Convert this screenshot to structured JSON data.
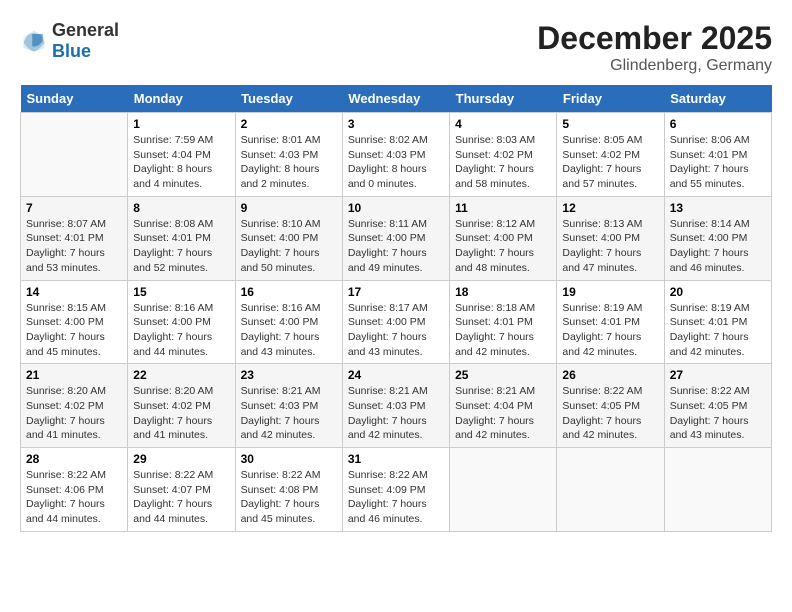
{
  "header": {
    "logo_general": "General",
    "logo_blue": "Blue",
    "title": "December 2025",
    "location": "Glindenberg, Germany"
  },
  "days_of_week": [
    "Sunday",
    "Monday",
    "Tuesday",
    "Wednesday",
    "Thursday",
    "Friday",
    "Saturday"
  ],
  "weeks": [
    [
      {
        "day": "",
        "sunrise": "",
        "sunset": "",
        "daylight": ""
      },
      {
        "day": "1",
        "sunrise": "Sunrise: 7:59 AM",
        "sunset": "Sunset: 4:04 PM",
        "daylight": "Daylight: 8 hours and 4 minutes."
      },
      {
        "day": "2",
        "sunrise": "Sunrise: 8:01 AM",
        "sunset": "Sunset: 4:03 PM",
        "daylight": "Daylight: 8 hours and 2 minutes."
      },
      {
        "day": "3",
        "sunrise": "Sunrise: 8:02 AM",
        "sunset": "Sunset: 4:03 PM",
        "daylight": "Daylight: 8 hours and 0 minutes."
      },
      {
        "day": "4",
        "sunrise": "Sunrise: 8:03 AM",
        "sunset": "Sunset: 4:02 PM",
        "daylight": "Daylight: 7 hours and 58 minutes."
      },
      {
        "day": "5",
        "sunrise": "Sunrise: 8:05 AM",
        "sunset": "Sunset: 4:02 PM",
        "daylight": "Daylight: 7 hours and 57 minutes."
      },
      {
        "day": "6",
        "sunrise": "Sunrise: 8:06 AM",
        "sunset": "Sunset: 4:01 PM",
        "daylight": "Daylight: 7 hours and 55 minutes."
      }
    ],
    [
      {
        "day": "7",
        "sunrise": "Sunrise: 8:07 AM",
        "sunset": "Sunset: 4:01 PM",
        "daylight": "Daylight: 7 hours and 53 minutes."
      },
      {
        "day": "8",
        "sunrise": "Sunrise: 8:08 AM",
        "sunset": "Sunset: 4:01 PM",
        "daylight": "Daylight: 7 hours and 52 minutes."
      },
      {
        "day": "9",
        "sunrise": "Sunrise: 8:10 AM",
        "sunset": "Sunset: 4:00 PM",
        "daylight": "Daylight: 7 hours and 50 minutes."
      },
      {
        "day": "10",
        "sunrise": "Sunrise: 8:11 AM",
        "sunset": "Sunset: 4:00 PM",
        "daylight": "Daylight: 7 hours and 49 minutes."
      },
      {
        "day": "11",
        "sunrise": "Sunrise: 8:12 AM",
        "sunset": "Sunset: 4:00 PM",
        "daylight": "Daylight: 7 hours and 48 minutes."
      },
      {
        "day": "12",
        "sunrise": "Sunrise: 8:13 AM",
        "sunset": "Sunset: 4:00 PM",
        "daylight": "Daylight: 7 hours and 47 minutes."
      },
      {
        "day": "13",
        "sunrise": "Sunrise: 8:14 AM",
        "sunset": "Sunset: 4:00 PM",
        "daylight": "Daylight: 7 hours and 46 minutes."
      }
    ],
    [
      {
        "day": "14",
        "sunrise": "Sunrise: 8:15 AM",
        "sunset": "Sunset: 4:00 PM",
        "daylight": "Daylight: 7 hours and 45 minutes."
      },
      {
        "day": "15",
        "sunrise": "Sunrise: 8:16 AM",
        "sunset": "Sunset: 4:00 PM",
        "daylight": "Daylight: 7 hours and 44 minutes."
      },
      {
        "day": "16",
        "sunrise": "Sunrise: 8:16 AM",
        "sunset": "Sunset: 4:00 PM",
        "daylight": "Daylight: 7 hours and 43 minutes."
      },
      {
        "day": "17",
        "sunrise": "Sunrise: 8:17 AM",
        "sunset": "Sunset: 4:00 PM",
        "daylight": "Daylight: 7 hours and 43 minutes."
      },
      {
        "day": "18",
        "sunrise": "Sunrise: 8:18 AM",
        "sunset": "Sunset: 4:01 PM",
        "daylight": "Daylight: 7 hours and 42 minutes."
      },
      {
        "day": "19",
        "sunrise": "Sunrise: 8:19 AM",
        "sunset": "Sunset: 4:01 PM",
        "daylight": "Daylight: 7 hours and 42 minutes."
      },
      {
        "day": "20",
        "sunrise": "Sunrise: 8:19 AM",
        "sunset": "Sunset: 4:01 PM",
        "daylight": "Daylight: 7 hours and 42 minutes."
      }
    ],
    [
      {
        "day": "21",
        "sunrise": "Sunrise: 8:20 AM",
        "sunset": "Sunset: 4:02 PM",
        "daylight": "Daylight: 7 hours and 41 minutes."
      },
      {
        "day": "22",
        "sunrise": "Sunrise: 8:20 AM",
        "sunset": "Sunset: 4:02 PM",
        "daylight": "Daylight: 7 hours and 41 minutes."
      },
      {
        "day": "23",
        "sunrise": "Sunrise: 8:21 AM",
        "sunset": "Sunset: 4:03 PM",
        "daylight": "Daylight: 7 hours and 42 minutes."
      },
      {
        "day": "24",
        "sunrise": "Sunrise: 8:21 AM",
        "sunset": "Sunset: 4:03 PM",
        "daylight": "Daylight: 7 hours and 42 minutes."
      },
      {
        "day": "25",
        "sunrise": "Sunrise: 8:21 AM",
        "sunset": "Sunset: 4:04 PM",
        "daylight": "Daylight: 7 hours and 42 minutes."
      },
      {
        "day": "26",
        "sunrise": "Sunrise: 8:22 AM",
        "sunset": "Sunset: 4:05 PM",
        "daylight": "Daylight: 7 hours and 42 minutes."
      },
      {
        "day": "27",
        "sunrise": "Sunrise: 8:22 AM",
        "sunset": "Sunset: 4:05 PM",
        "daylight": "Daylight: 7 hours and 43 minutes."
      }
    ],
    [
      {
        "day": "28",
        "sunrise": "Sunrise: 8:22 AM",
        "sunset": "Sunset: 4:06 PM",
        "daylight": "Daylight: 7 hours and 44 minutes."
      },
      {
        "day": "29",
        "sunrise": "Sunrise: 8:22 AM",
        "sunset": "Sunset: 4:07 PM",
        "daylight": "Daylight: 7 hours and 44 minutes."
      },
      {
        "day": "30",
        "sunrise": "Sunrise: 8:22 AM",
        "sunset": "Sunset: 4:08 PM",
        "daylight": "Daylight: 7 hours and 45 minutes."
      },
      {
        "day": "31",
        "sunrise": "Sunrise: 8:22 AM",
        "sunset": "Sunset: 4:09 PM",
        "daylight": "Daylight: 7 hours and 46 minutes."
      },
      {
        "day": "",
        "sunrise": "",
        "sunset": "",
        "daylight": ""
      },
      {
        "day": "",
        "sunrise": "",
        "sunset": "",
        "daylight": ""
      },
      {
        "day": "",
        "sunrise": "",
        "sunset": "",
        "daylight": ""
      }
    ]
  ]
}
